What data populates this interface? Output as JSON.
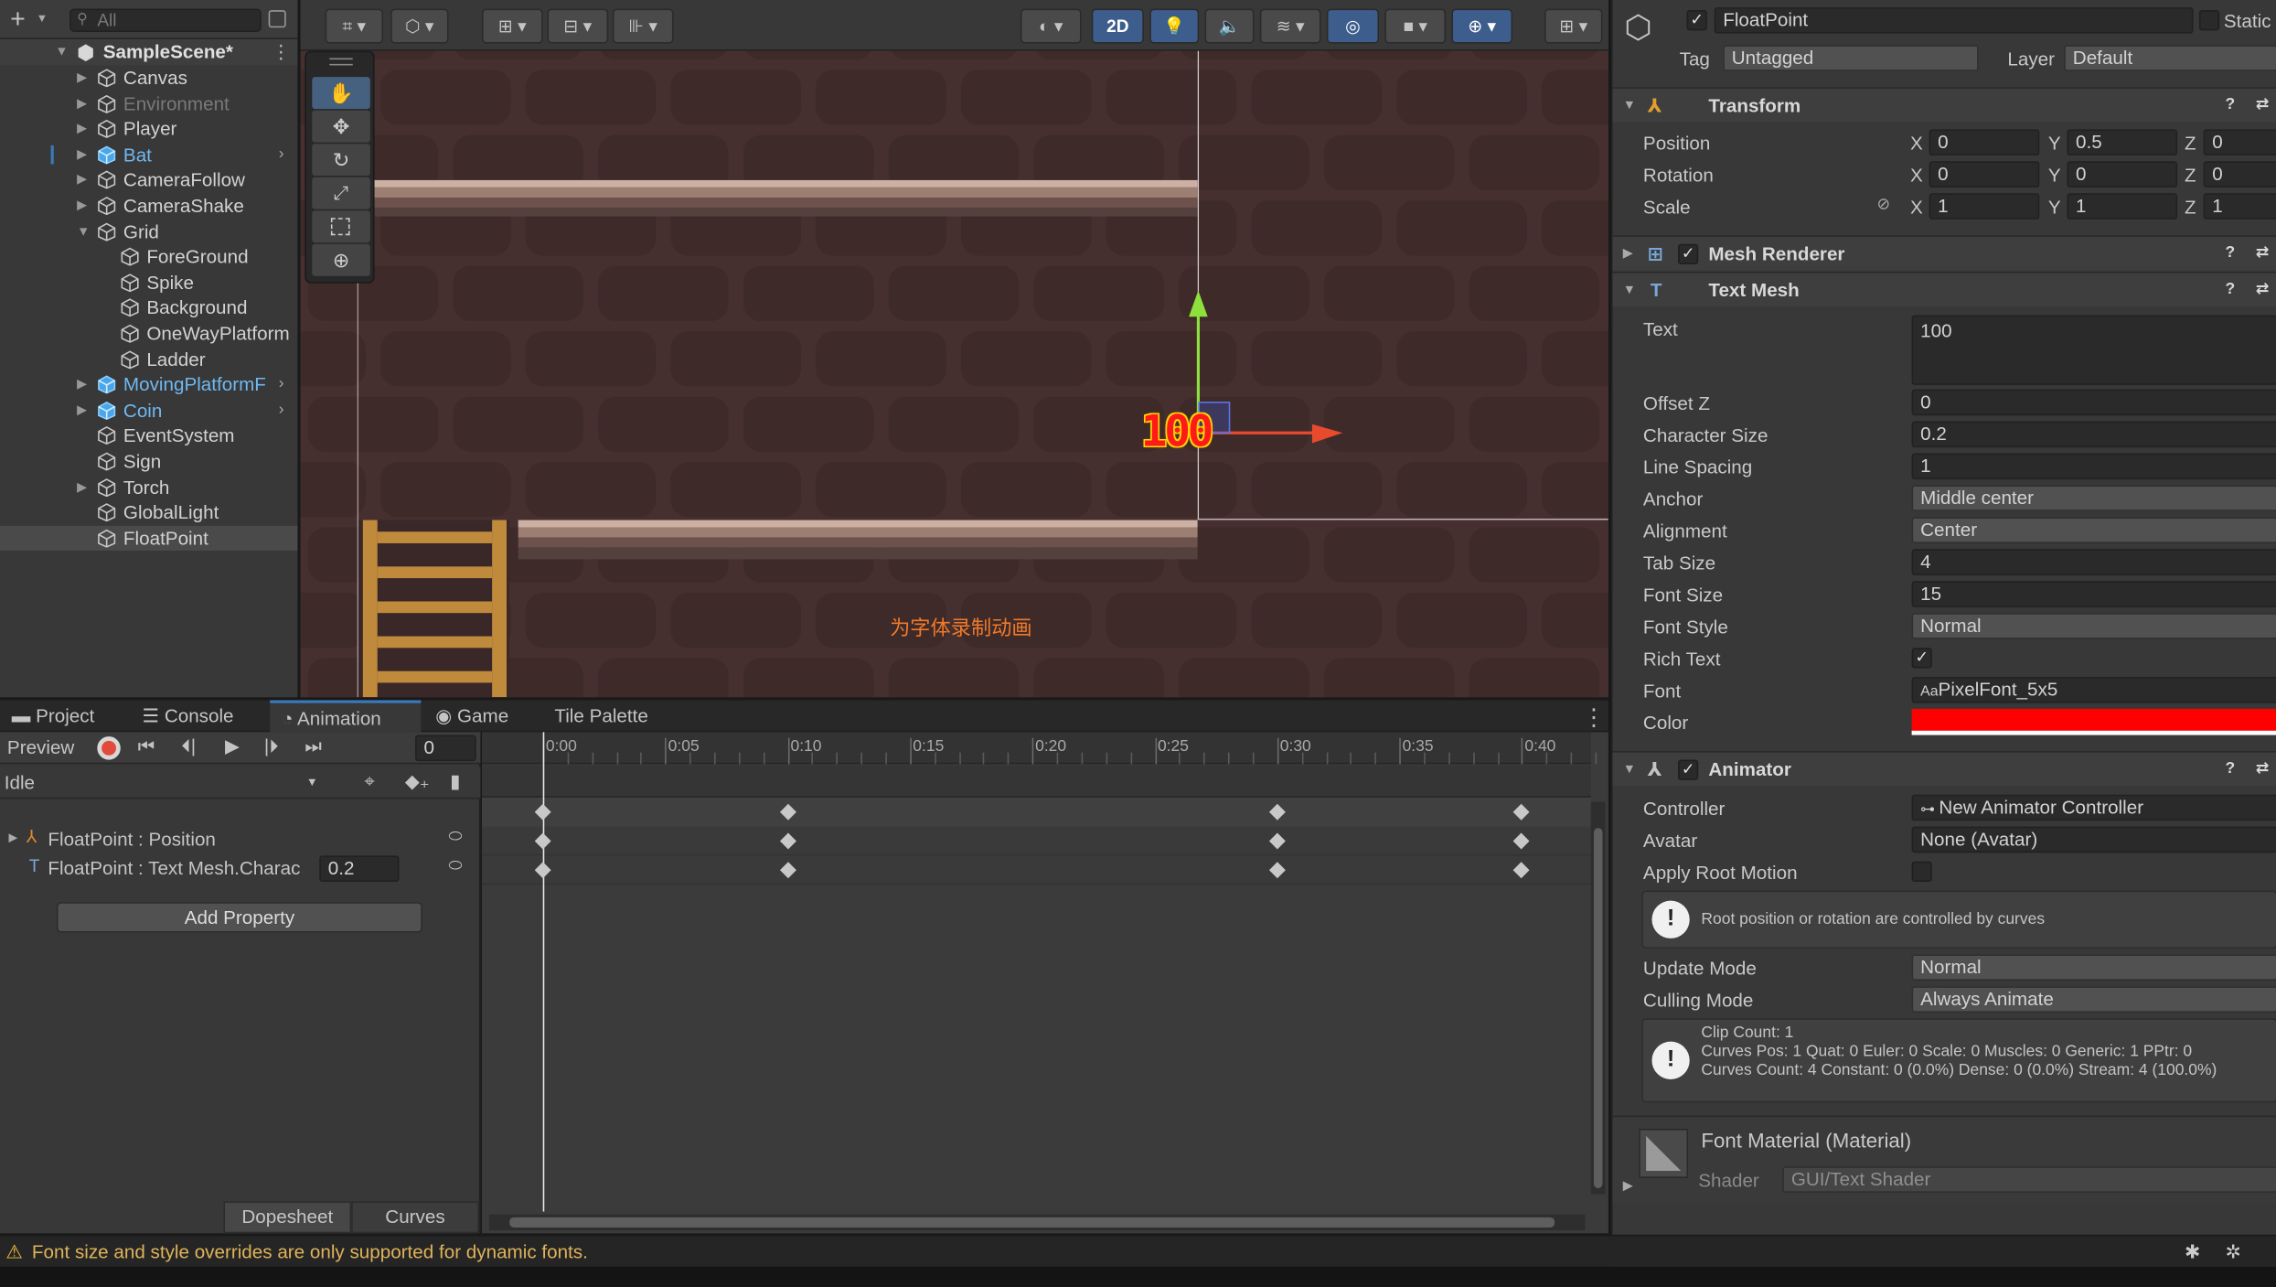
{
  "hierarchy": {
    "search_placeholder": "All",
    "scene": "SampleScene*",
    "items": [
      {
        "label": "Canvas",
        "depth": 1,
        "arrow": true,
        "prefab": false,
        "dim": false
      },
      {
        "label": "Environment",
        "depth": 1,
        "arrow": true,
        "prefab": false,
        "dim": true
      },
      {
        "label": "Player",
        "depth": 1,
        "arrow": true,
        "prefab": false,
        "dim": false
      },
      {
        "label": "Bat",
        "depth": 1,
        "arrow": true,
        "prefab": true,
        "dim": false
      },
      {
        "label": "CameraFollow",
        "depth": 1,
        "arrow": true,
        "prefab": false,
        "dim": false
      },
      {
        "label": "CameraShake",
        "depth": 1,
        "arrow": true,
        "prefab": false,
        "dim": false
      },
      {
        "label": "Grid",
        "depth": 1,
        "arrow": true,
        "open": true,
        "prefab": false,
        "dim": false
      },
      {
        "label": "ForeGround",
        "depth": 2,
        "arrow": false,
        "prefab": false,
        "dim": false
      },
      {
        "label": "Spike",
        "depth": 2,
        "arrow": false,
        "prefab": false,
        "dim": false
      },
      {
        "label": "Background",
        "depth": 2,
        "arrow": false,
        "prefab": false,
        "dim": false
      },
      {
        "label": "OneWayPlatform",
        "depth": 2,
        "arrow": false,
        "prefab": false,
        "dim": false
      },
      {
        "label": "Ladder",
        "depth": 2,
        "arrow": false,
        "prefab": false,
        "dim": false
      },
      {
        "label": "MovingPlatformF",
        "depth": 1,
        "arrow": true,
        "prefab": true,
        "dim": false
      },
      {
        "label": "Coin",
        "depth": 1,
        "arrow": true,
        "prefab": true,
        "dim": false
      },
      {
        "label": "EventSystem",
        "depth": 1,
        "arrow": false,
        "prefab": false,
        "dim": false
      },
      {
        "label": "Sign",
        "depth": 1,
        "arrow": false,
        "prefab": false,
        "dim": false
      },
      {
        "label": "Torch",
        "depth": 1,
        "arrow": true,
        "prefab": false,
        "dim": false
      },
      {
        "label": "GlobalLight",
        "depth": 1,
        "arrow": false,
        "prefab": false,
        "dim": false
      },
      {
        "label": "FloatPoint",
        "depth": 1,
        "arrow": false,
        "prefab": false,
        "dim": false,
        "selected": true
      }
    ]
  },
  "scene_view": {
    "mode_2d": "2D",
    "text_mesh_value": "100",
    "annotation": "为字体录制动画"
  },
  "tabs": [
    "Project",
    "Console",
    "Animation",
    "Game",
    "Tile Palette"
  ],
  "animation": {
    "preview": "Preview",
    "frame": "0",
    "clip": "Idle",
    "properties": [
      {
        "label": "FloatPoint : Position",
        "value": ""
      },
      {
        "label": "FloatPoint : Text Mesh.Charac",
        "value": "0.2"
      }
    ],
    "add_property": "Add Property",
    "dopesheet": "Dopesheet",
    "curves": "Curves",
    "ticks": [
      "0:00",
      "0:05",
      "0:10",
      "0:15",
      "0:20",
      "0:25",
      "0:30",
      "0:35",
      "0:40"
    ],
    "keyframe_ticks": [
      "0:00",
      "0:10",
      "0:30",
      "0:40"
    ]
  },
  "inspector": {
    "object_name": "FloatPoint",
    "static": "Static",
    "tag_label": "Tag",
    "tag": "Untagged",
    "layer_label": "Layer",
    "layer": "Default",
    "transform": {
      "title": "Transform",
      "rows": [
        {
          "label": "Position",
          "x": "0",
          "y": "0.5",
          "z": "0"
        },
        {
          "label": "Rotation",
          "x": "0",
          "y": "0",
          "z": "0"
        },
        {
          "label": "Scale",
          "x": "1",
          "y": "1",
          "z": "1"
        }
      ]
    },
    "mesh_renderer": "Mesh Renderer",
    "text_mesh": {
      "title": "Text Mesh",
      "rows": [
        {
          "label": "Text",
          "value": "100"
        },
        {
          "label": "Offset Z",
          "value": "0"
        },
        {
          "label": "Character Size",
          "value": "0.2"
        },
        {
          "label": "Line Spacing",
          "value": "1"
        },
        {
          "label": "Anchor",
          "value": "Middle center"
        },
        {
          "label": "Alignment",
          "value": "Center"
        },
        {
          "label": "Tab Size",
          "value": "4"
        },
        {
          "label": "Font Size",
          "value": "15"
        },
        {
          "label": "Font Style",
          "value": "Normal"
        },
        {
          "label": "Rich Text",
          "value": "✓"
        },
        {
          "label": "Font",
          "value": "PixelFont_5x5"
        },
        {
          "label": "Color",
          "value": ""
        }
      ],
      "color_swatch": "#ff0000"
    },
    "animator": {
      "title": "Animator",
      "rows": [
        {
          "label": "Controller",
          "value": "New Animator Controller"
        },
        {
          "label": "Avatar",
          "value": "None (Avatar)"
        },
        {
          "label": "Apply Root Motion",
          "value": ""
        }
      ],
      "root_note": "Root position or rotation are controlled by curves",
      "update_mode_label": "Update Mode",
      "update_mode": "Normal",
      "culling_mode_label": "Culling Mode",
      "culling_mode": "Always Animate",
      "info_1": "Clip Count: 1",
      "info_2": "Curves Pos: 1 Quat: 0 Euler: 0 Scale: 0 Muscles: 0 Generic: 1 PPtr: 0",
      "info_3": "Curves Count: 4 Constant: 0 (0.0%) Dense: 0 (0.0%) Stream: 4 (100.0%)"
    },
    "material": {
      "title": "Font Material (Material)",
      "shader_label": "Shader",
      "shader": "GUI/Text Shader"
    }
  },
  "status_bar": {
    "message": "Font size and style overrides are only supported for dynamic fonts."
  }
}
